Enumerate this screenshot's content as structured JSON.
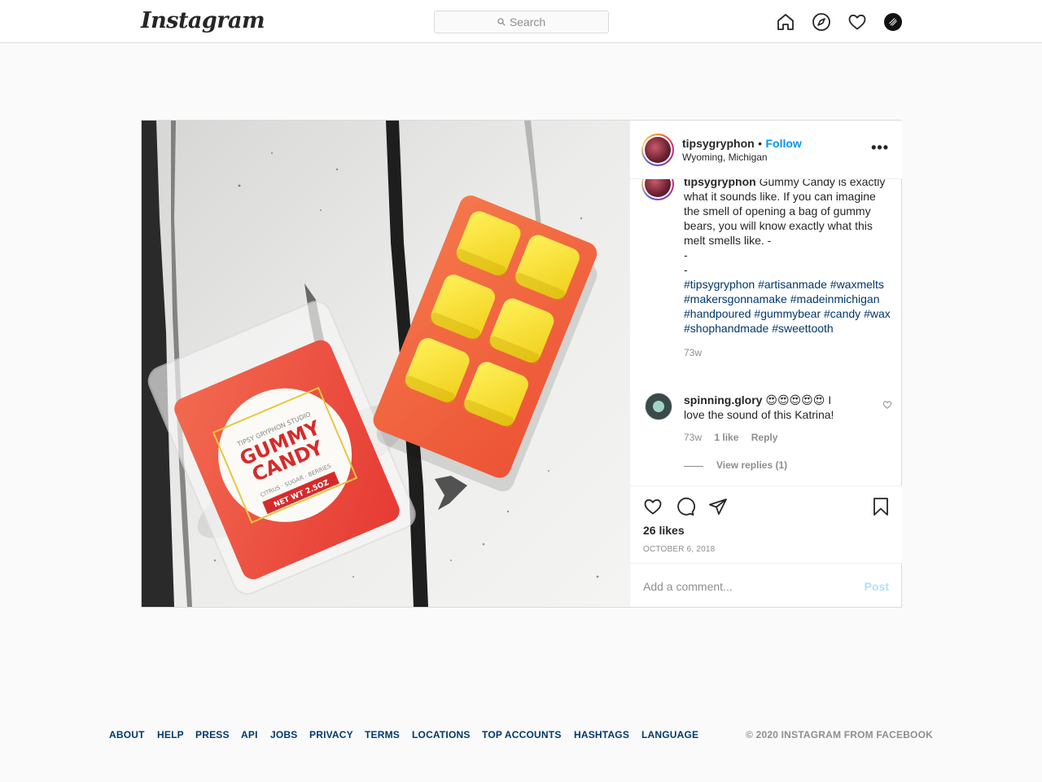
{
  "nav": {
    "logo": "Instagram",
    "search_placeholder": "Search"
  },
  "post": {
    "username": "tipsygryphon",
    "follow_label": "Follow",
    "separator": "•",
    "location": "Wyoming, Michigan",
    "more_label": "•••",
    "product": {
      "label_studio": "TIPSY GRYPHON STUDIO",
      "label_title_1": "GUMMY",
      "label_title_2": "CANDY",
      "label_notes": "CITRUS · SUGAR · BERRIES",
      "label_weight": "NET WT 2.5OZ"
    },
    "caption": {
      "username": "tipsygryphon",
      "text": "Gummy Candy is exactly what it sounds like. If you can imagine the smell of opening a bag of gummy bears, you will know exactly what this melt smells like. -",
      "dash1": "-",
      "dash2": "-",
      "hashtags": [
        "#tipsygryphon",
        "#artisanmade",
        "#waxmelts",
        "#makersgonnamake",
        "#madeinmichigan",
        "#handpoured",
        "#gummybear",
        "#candy",
        "#wax",
        "#shophandmade",
        "#sweettooth"
      ],
      "time": "73w"
    },
    "comment": {
      "username": "spinning.glory",
      "emojis": "😍😍😍😍😍",
      "text": "I love the sound of this Katrina!",
      "time": "73w",
      "likes": "1 like",
      "reply_label": "Reply",
      "view_replies": "View replies (1)"
    },
    "likes": "26 likes",
    "date": "OCTOBER 6, 2018",
    "add_comment_placeholder": "Add a comment...",
    "post_label": "Post"
  },
  "footer": {
    "links": [
      "ABOUT",
      "HELP",
      "PRESS",
      "API",
      "JOBS",
      "PRIVACY",
      "TERMS",
      "LOCATIONS",
      "TOP ACCOUNTS",
      "HASHTAGS",
      "LANGUAGE"
    ],
    "copyright": "© 2020 INSTAGRAM FROM FACEBOOK"
  },
  "icons": {
    "home": "home-icon",
    "explore": "compass-icon",
    "activity": "heart-icon",
    "like": "heart-outline-icon",
    "comment": "comment-bubble-icon",
    "share": "paper-plane-icon",
    "save": "bookmark-icon"
  },
  "colors": {
    "link_blue": "#0095f6",
    "hashtag": "#00376b",
    "muted": "#8e8e8e",
    "post_disabled": "#b2dffc",
    "border": "#dbdbdb"
  }
}
